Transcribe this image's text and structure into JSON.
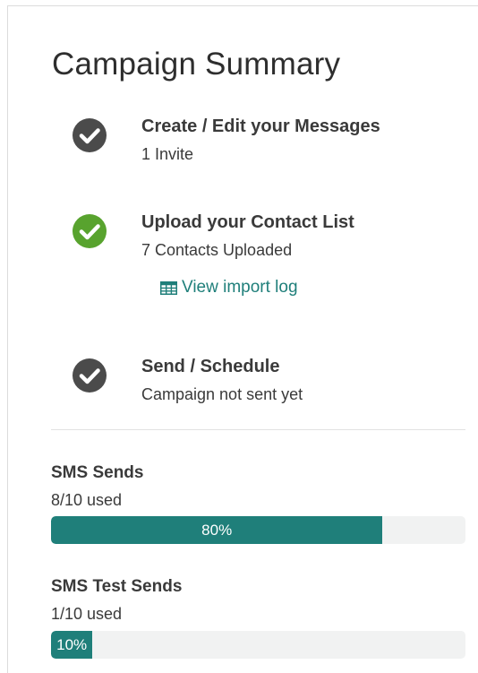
{
  "summary": {
    "title": "Campaign Summary",
    "steps": [
      {
        "title": "Create / Edit your Messages",
        "subtitle": "1 Invite",
        "status": "complete",
        "check_color": "#4b4b4b"
      },
      {
        "title": "Upload your Contact List",
        "subtitle": "7 Contacts Uploaded",
        "status": "success",
        "check_color": "#58a32e"
      },
      {
        "title": "Send / Schedule",
        "subtitle": "Campaign not sent yet",
        "status": "complete",
        "check_color": "#4b4b4b"
      }
    ],
    "import_log_link": "View import log",
    "import_log_icon": "table-icon"
  },
  "quotas": [
    {
      "title": "SMS Sends",
      "used_text": "8/10 used",
      "percent_label": "80%",
      "percent": 80
    },
    {
      "title": "SMS Test Sends",
      "used_text": "1/10 used",
      "percent_label": "10%",
      "percent": 10
    }
  ],
  "colors": {
    "accent": "#1f7f7a",
    "success": "#58a32e",
    "neutral_check": "#4b4b4b"
  }
}
